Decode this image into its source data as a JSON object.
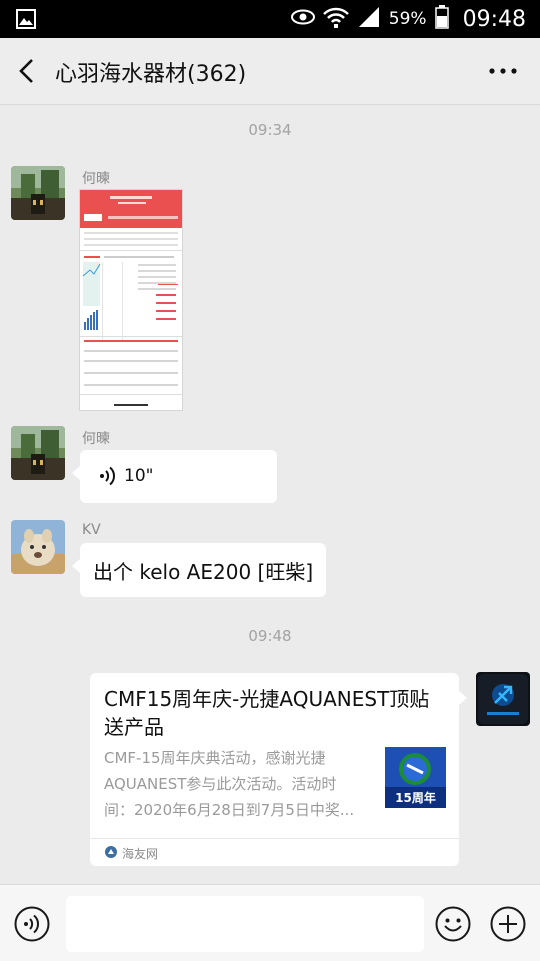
{
  "status_bar": {
    "battery": "59%",
    "time": "09:48"
  },
  "header": {
    "title": "心羽海水器材(362)"
  },
  "icons": {
    "back": "chevron-left-icon",
    "more": "more-dots-icon",
    "voice_toggle": "voice-input-icon",
    "emoji": "emoji-icon",
    "plus": "plus-circle-icon"
  },
  "timestamps": [
    "09:34",
    "09:48"
  ],
  "messages": [
    {
      "sender": "何暕",
      "type": "image"
    },
    {
      "sender": "何暕",
      "type": "voice",
      "duration": "10\""
    },
    {
      "sender": "KV",
      "type": "text",
      "text": "出个 kelo AE200 [旺柴]"
    },
    {
      "sender": "self",
      "type": "link",
      "title": "CMF15周年庆-光捷AQUANEST顶贴送产品",
      "description": "CMF-15周年庆典活动，感谢光捷AQUANEST参与此次活动。活动时间：2020年6月28日到7月5日中奖...",
      "source": "海友网",
      "thumb_text": "15周年"
    }
  ],
  "colors": {
    "background": "#ebebeb",
    "bubble": "#ffffff",
    "status_bar": "#000000"
  }
}
